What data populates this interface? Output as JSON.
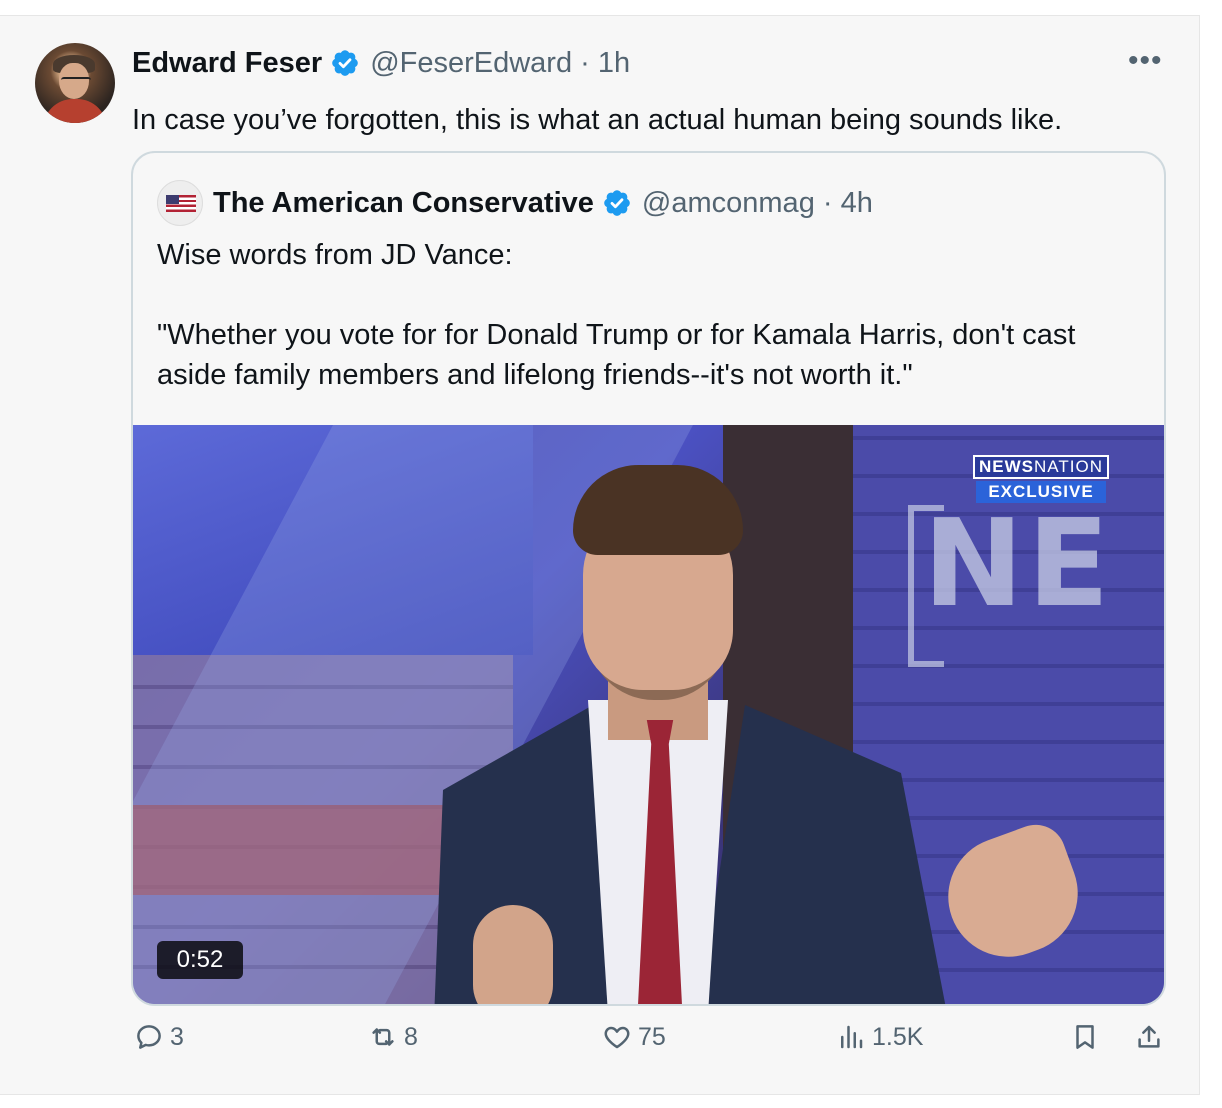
{
  "tweet": {
    "author_name": "Edward Feser",
    "author_handle": "@FeserEdward · 1h",
    "text": "In case you’ve forgotten, this is what an actual human being sounds like.",
    "more_label": "•••"
  },
  "quote": {
    "author_name": "The American Conservative",
    "author_handle": "@amconmag · 4h",
    "text_line1": "Wise words from JD Vance:",
    "text_line2a": "\"Whether you vote for for Donald Trump or for Kamala Harris, don't cast",
    "text_line2b": "aside family members and lifelong friends--it's not worth it.\"",
    "media": {
      "badge_top_bold": "NEWS",
      "badge_top_rest": "NATION",
      "badge_bottom": "EXCLUSIVE",
      "background_letters": "NE",
      "duration": "0:52"
    }
  },
  "actions": {
    "replies": "3",
    "reposts": "8",
    "likes": "75",
    "views": "1.5K"
  },
  "colors": {
    "verified": "#1d9bf0",
    "secondary_text": "#536471",
    "primary_text": "#0f1419",
    "border": "#cfd9de",
    "background": "#f7f7f7"
  },
  "icons": [
    "reply-icon",
    "repost-icon",
    "like-icon",
    "views-icon",
    "bookmark-icon",
    "share-icon",
    "verified-badge-icon",
    "more-icon"
  ]
}
